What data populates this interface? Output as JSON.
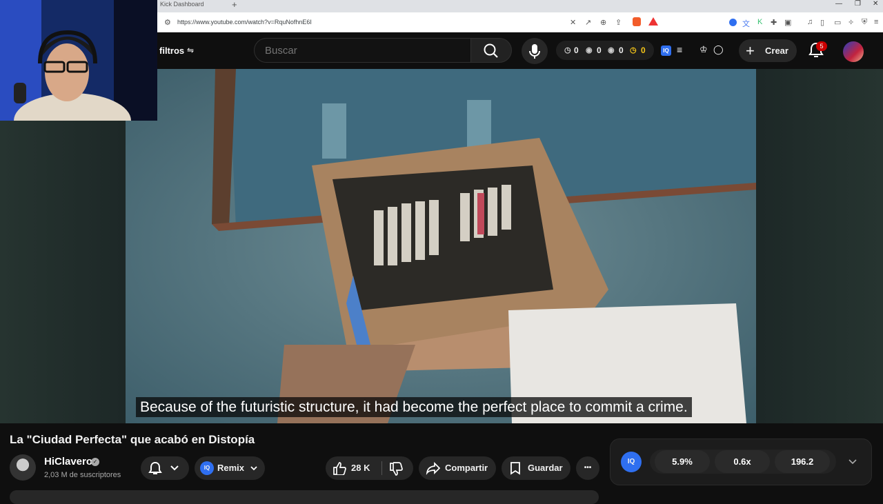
{
  "browser": {
    "tab_title": "Kick Dashboard",
    "new_tab": "+",
    "url": "https://www.youtube.com/watch?v=RquNofhnE6I",
    "window_controls": [
      "—",
      "❐",
      "✕"
    ]
  },
  "header": {
    "filters_label": "filtros",
    "search_placeholder": "Buscar",
    "stats": [
      "0",
      "0",
      "0",
      "0"
    ],
    "stats_colors": [
      "#ffffff",
      "#ffffff",
      "#ffffff",
      "#f5c518"
    ],
    "iq_label": "IQ",
    "create_label": "Crear",
    "notification_count": "5"
  },
  "video": {
    "subtitle": "Because of the futuristic structure, it had become the perfect place to commit a crime."
  },
  "below": {
    "title": "La \"Ciudad Perfecta\" que acabó en Distopía",
    "channel_name": "HiClavero",
    "subscribers": "2,03 M de suscriptores",
    "remix_label": "Remix",
    "remix_iq": "IQ",
    "likes": "28 K",
    "share_label": "Compartir",
    "save_label": "Guardar",
    "more_label": "•••"
  },
  "iq_panel": {
    "logo": "IQ",
    "values": [
      "5.9%",
      "0.6x",
      "196.2"
    ]
  },
  "colors": {
    "accent_blue": "#2f6ff0",
    "notification_red": "#cc0000",
    "background": "#0f0f0f"
  }
}
